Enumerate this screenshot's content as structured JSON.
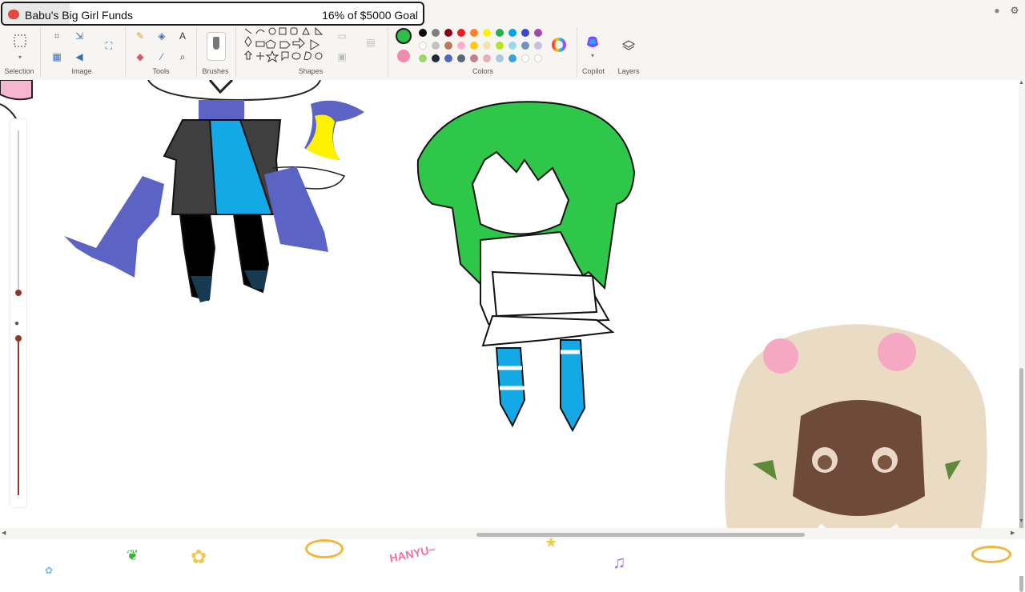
{
  "app": {
    "groups": {
      "selection": "Selection",
      "image": "Image",
      "tools": "Tools",
      "brushes": "Brushes",
      "shapes": "Shapes",
      "colors": "Colors",
      "copilot": "Copilot",
      "layers": "Layers"
    },
    "primary_color": "#2dbf4a",
    "secondary_color": "#f08bb0",
    "palette_row1": [
      "#000000",
      "#7f7f7f",
      "#880015",
      "#ed1c24",
      "#ff7f27",
      "#fff200",
      "#22b14c",
      "#00a2e8",
      "#3f48cc",
      "#a349a4"
    ],
    "palette_row2": [
      "#ffffff",
      "#c3c3c3",
      "#b97a57",
      "#ffaec9",
      "#ffc90e",
      "#efe4b0",
      "#b5e61d",
      "#99d9ea",
      "#7092be",
      "#c8bfe7"
    ],
    "palette_row3": [
      "#9bd66a",
      "#1e2b3a",
      "#4a69bd",
      "#5b6677",
      "#c08090",
      "#e7b0b8",
      "#a8c9e0",
      "#38a1d8",
      "#ffffff",
      "#ffffff"
    ]
  },
  "goal": {
    "title": "Babu's Big Girl Funds",
    "amount_text": "16% of $5000 Goal",
    "progress_percent": 16
  },
  "overlay": {
    "sticker_text": "HANYU~"
  }
}
